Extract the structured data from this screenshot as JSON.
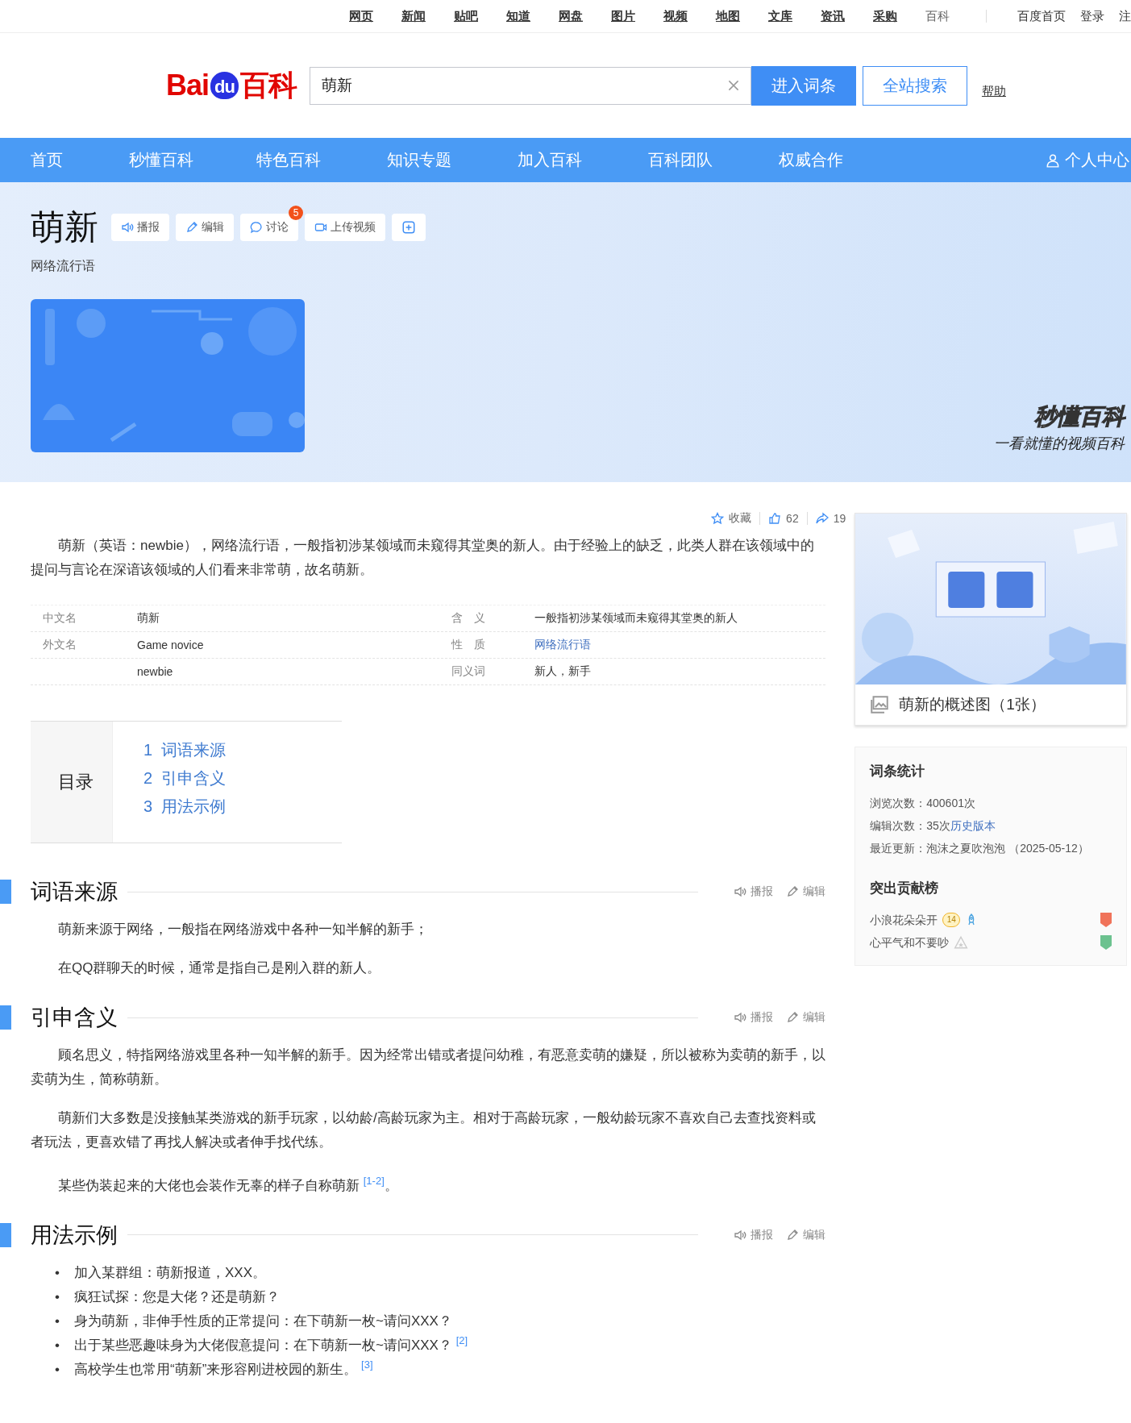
{
  "top_links": [
    {
      "label": "网页",
      "selected": false
    },
    {
      "label": "新闻",
      "selected": false
    },
    {
      "label": "贴吧",
      "selected": false
    },
    {
      "label": "知道",
      "selected": false
    },
    {
      "label": "网盘",
      "selected": false
    },
    {
      "label": "图片",
      "selected": false
    },
    {
      "label": "视频",
      "selected": false
    },
    {
      "label": "地图",
      "selected": false
    },
    {
      "label": "文库",
      "selected": false
    },
    {
      "label": "资讯",
      "selected": false
    },
    {
      "label": "采购",
      "selected": false
    },
    {
      "label": "百科",
      "selected": true
    }
  ],
  "top_right": [
    "百度首页",
    "登录",
    "注"
  ],
  "logo": {
    "latin": "Bai",
    "mark": "du",
    "cn": "百科"
  },
  "search": {
    "value": "萌新",
    "buttons": [
      {
        "label": "进入词条",
        "kind": "primary"
      },
      {
        "label": "全站搜索",
        "kind": "outline"
      }
    ],
    "help": "帮助"
  },
  "nav": {
    "items": [
      "首页",
      "秒懂百科",
      "特色百科",
      "知识专题",
      "加入百科",
      "百科团队",
      "权威合作"
    ],
    "user": "个人中心"
  },
  "title": "萌新",
  "actions": [
    {
      "label": "播报",
      "kind": "speaker"
    },
    {
      "label": "编辑",
      "kind": "pencil"
    },
    {
      "label": "讨论",
      "kind": "chat",
      "badge": "5"
    },
    {
      "label": "上传视频",
      "kind": "video"
    },
    {
      "kind": "plus"
    }
  ],
  "subtitle": "网络流行语",
  "banner": {
    "brand": "秒懂百科",
    "slogan": "一看就懂的视频百科"
  },
  "stats": {
    "collect": "收藏",
    "likes": "62",
    "shares": "19"
  },
  "summary": "萌新（英语：newbie），网络流行语，一般指初涉某领域而未窥得其堂奥的新人。由于经验上的缺乏，此类人群在该领域中的提问与言论在深谙该领域的人们看来非常萌，故名萌新。",
  "infobox": [
    {
      "label_1": "中文名",
      "value_1": "萌新",
      "label_2": "含　义",
      "value_2": "一般指初涉某领域而未窥得其堂奥的新人",
      "link_2": false
    },
    {
      "label_1": "外文名",
      "value_1": "Game novice",
      "label_2": "性　质",
      "value_2": "网络流行语",
      "link_2": true
    },
    {
      "value_1": "newbie",
      "label_2": "同义词",
      "value_2": "新人，新手",
      "link_2": false
    }
  ],
  "toc": {
    "title": "目录",
    "items": [
      {
        "num": "1",
        "label": "词语来源"
      },
      {
        "num": "2",
        "label": "引申含义"
      },
      {
        "num": "3",
        "label": "用法示例"
      }
    ]
  },
  "sections": [
    {
      "title": "词语来源",
      "actions": [
        "播报",
        "编辑"
      ],
      "kind": "paragraphs",
      "items": [
        "萌新来源于网络，一般指在网络游戏中各种一知半解的新手；",
        "在QQ群聊天的时候，通常是指自己是刚入群的新人。"
      ]
    },
    {
      "title": "引申含义",
      "actions": [
        "播报",
        "编辑"
      ],
      "kind": "paragraphs",
      "items": [
        "顾名思义，特指网络游戏里各种一知半解的新手。因为经常出错或者提问幼稚，有恶意卖萌的嫌疑，所以被称为卖萌的新手，以卖萌为生，简称萌新。",
        "萌新们大多数是没接触某类游戏的新手玩家，以幼龄/高龄玩家为主。相对于高龄玩家，一般幼龄玩家不喜欢自己去查找资料或者玩法，更喜欢错了再找人解决或者伸手找代练。",
        "某些伪装起来的大佬也会装作无辜的样子自称萌新 $^{[1-2]}$。"
      ]
    },
    {
      "title": "用法示例",
      "actions": [
        "播报",
        "编辑"
      ],
      "kind": "bullets",
      "marker": "•",
      "items": [
        "加入某群组：萌新报道，XXX。",
        "疯狂试探：您是大佬？还是萌新？",
        "身为萌新，非伸手性质的正常提问：在下萌新一枚~请问XXX？",
        "出于某些恶趣味身为大佬假意提问：在下萌新一枚~请问XXX？ $^{[2]}$",
        "高校学生也常用“萌新”来形容刚进校园的新生。 $^{[3]}$"
      ]
    }
  ],
  "sidebar": {
    "album": {
      "caption": "萌新的概述图（1张）"
    },
    "card": {
      "title": "词条统计",
      "views": "浏览次数：400601次",
      "edits": "编辑次数：35次",
      "history": "历史版本",
      "updated": "最近更新：泡沫之夏吹泡泡 （2025-05-12）",
      "contrib_title": "突出贡献榜",
      "contributors": [
        {
          "name": "小浪花朵朵开",
          "badges": [
            {
              "kind": "level",
              "label": "14"
            },
            {
              "kind": "rocket"
            }
          ],
          "color": "#f0735a"
        },
        {
          "name": "心平气和不要吵",
          "badges": [
            {
              "kind": "star"
            }
          ],
          "color": "#6cc28f"
        }
      ]
    }
  }
}
